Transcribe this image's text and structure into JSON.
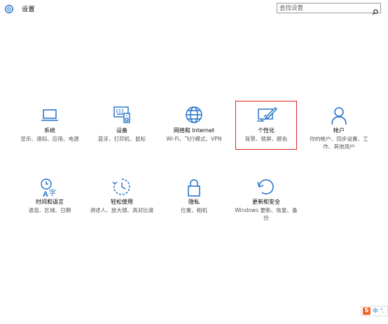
{
  "app": {
    "title": "设置"
  },
  "search": {
    "placeholder": "查找设置"
  },
  "tiles": [
    {
      "label": "系统",
      "desc": "显示、通知、应用、电源",
      "icon": "monitor-icon"
    },
    {
      "label": "设备",
      "desc": "蓝牙、打印机、鼠标",
      "icon": "devices-icon"
    },
    {
      "label": "网络和 Internet",
      "desc": "Wi-Fi、飞行模式、VPN",
      "icon": "globe-icon"
    },
    {
      "label": "个性化",
      "desc": "背景、锁屏、颜色",
      "icon": "personalization-icon"
    },
    {
      "label": "帐户",
      "desc": "你的帐户、同步设置、工作、其他用户",
      "icon": "person-icon"
    },
    {
      "label": "时间和语言",
      "desc": "语音、区域、日期",
      "icon": "time-language-icon"
    },
    {
      "label": "轻松使用",
      "desc": "讲述人、放大镜、高对比度",
      "icon": "ease-of-access-icon"
    },
    {
      "label": "隐私",
      "desc": "位置、相机",
      "icon": "lock-icon"
    },
    {
      "label": "更新和安全",
      "desc": "Windows 更新、恢复、备份",
      "icon": "update-icon"
    }
  ],
  "ime": {
    "logo": "S",
    "mode": "中",
    "punct": "°,"
  },
  "colors": {
    "accent": "#1f6fc9",
    "highlight": "#e02626"
  }
}
